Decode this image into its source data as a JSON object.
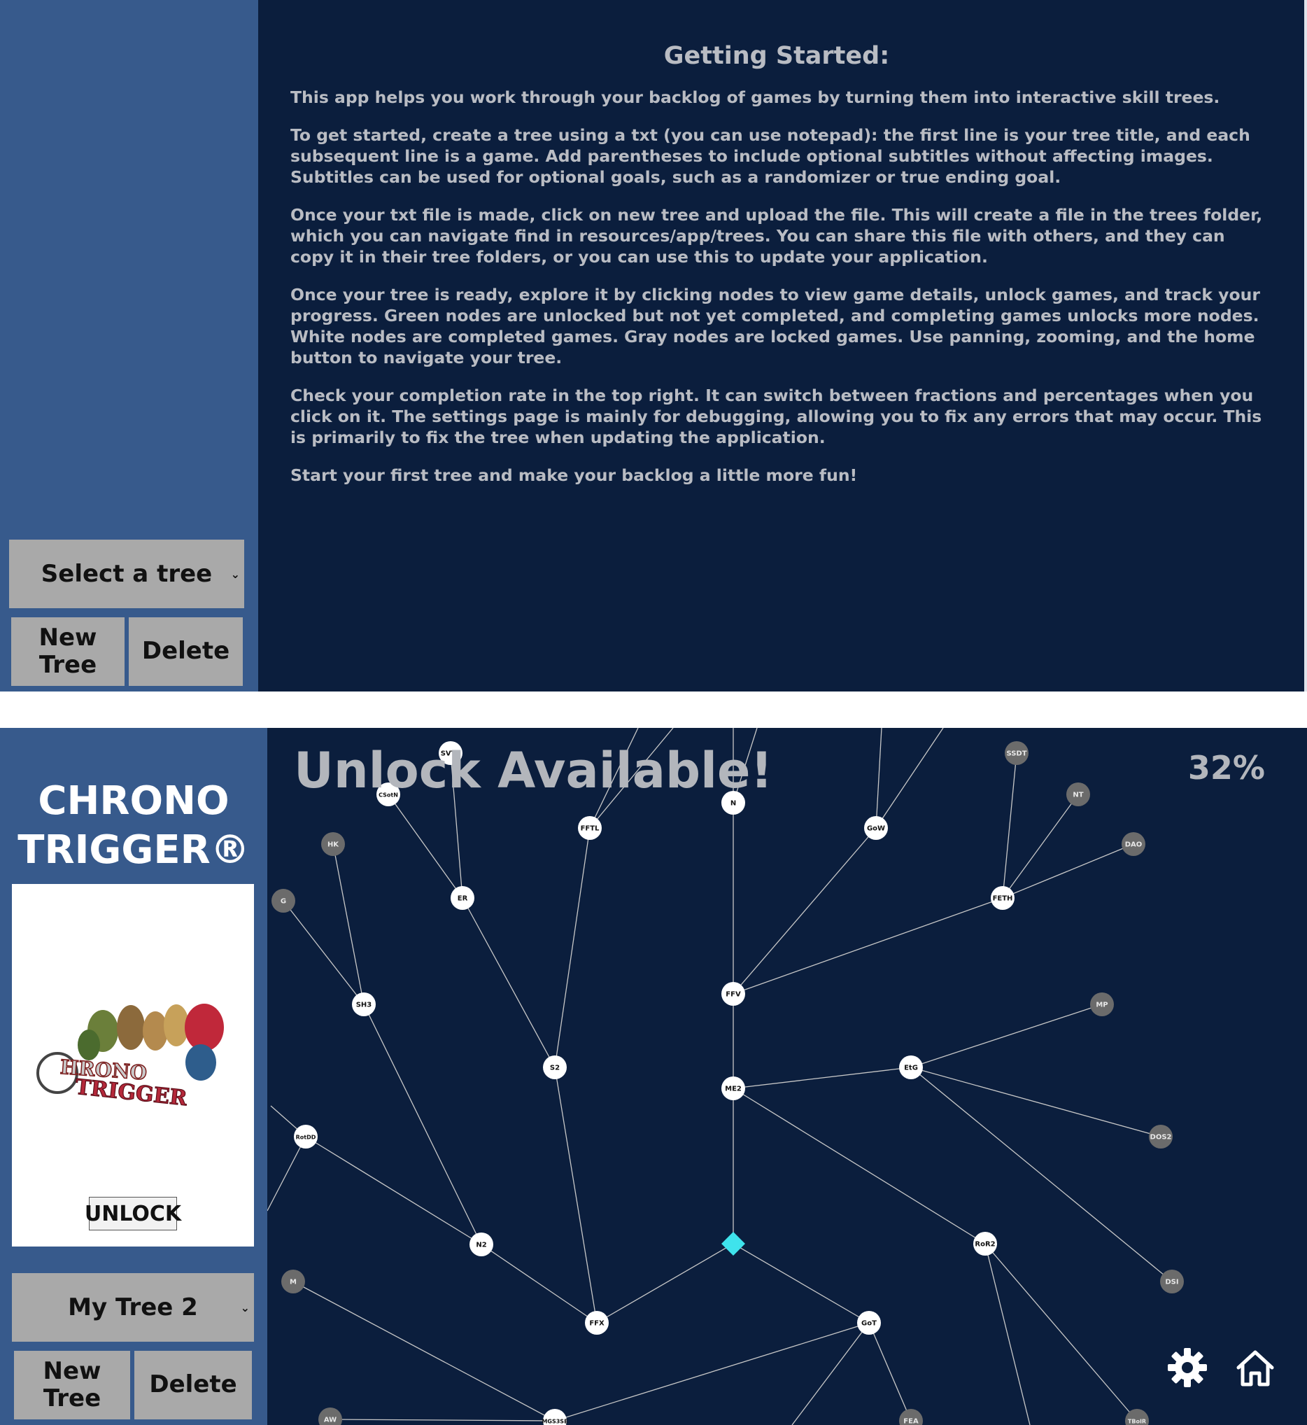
{
  "top_screen": {
    "heading": "Getting Started:",
    "paragraphs": [
      "This app helps you work through your backlog of games by turning them into interactive skill trees.",
      "To get started, create a tree using a txt (you can use notepad): the first line is your tree title, and each subsequent line is a game. Add parentheses to include optional subtitles without affecting images. Subtitles can be used for optional goals, such as a randomizer or true ending goal.",
      "Once your txt file is made, click on new tree and upload the file. This will create a file in the trees folder, which you can navigate find in resources/app/trees. You can share this file with others, and they can copy it in their tree folders, or you can use this to update your application.",
      "Once your tree is ready, explore it by clicking nodes to view game details, unlock games, and track your progress. Green nodes are unlocked but not yet completed, and completing games unlocks more nodes. White nodes are completed games. Gray nodes are locked games. Use panning, zooming, and the home button to navigate your tree.",
      "Check your completion rate in the top right. It can switch between fractions and percentages when you click on it. The settings page is mainly for debugging, allowing you to fix any errors that may occur. This is primarily to fix the tree when updating the application.",
      "Start your first tree and make your backlog a little more fun!"
    ],
    "tree_select": "Select a tree",
    "new_tree_button": "New Tree",
    "delete_button": "Delete"
  },
  "bottom_screen": {
    "game_title": "CHRONO TRIGGER®",
    "logo_text": "HRONO TRIGGER",
    "unlock_button": "UNLOCK",
    "tree_select": "My Tree 2",
    "new_tree_button": "New Tree",
    "delete_button": "Delete",
    "banner": "Unlock Available!",
    "completion": "32%",
    "icons": {
      "settings": "gear-icon",
      "home": "home-icon"
    }
  },
  "colors": {
    "background": "#0b1e3d",
    "sidebar": "#375a8c",
    "button": "#a9a9a9",
    "node_completed": "#ffffff",
    "node_locked": "#6b6b6b",
    "node_current": "#3fe3ec",
    "edge": "#c8c8c8",
    "text_muted": "#b3b6bc"
  },
  "tree_nodes": [
    {
      "id": "SVTF",
      "label": "SVTF",
      "state": "completed"
    },
    {
      "id": "SSDT",
      "label": "SSDT",
      "state": "locked"
    },
    {
      "id": "CSotN",
      "label": "CSotN",
      "state": "completed"
    },
    {
      "id": "N",
      "label": "N",
      "state": "completed"
    },
    {
      "id": "NT",
      "label": "NT",
      "state": "locked"
    },
    {
      "id": "FFTL",
      "label": "FFTL",
      "state": "completed"
    },
    {
      "id": "GoW",
      "label": "GoW",
      "state": "completed"
    },
    {
      "id": "HK",
      "label": "HK",
      "state": "locked"
    },
    {
      "id": "DAO",
      "label": "DAO",
      "state": "locked"
    },
    {
      "id": "ER",
      "label": "ER",
      "state": "completed"
    },
    {
      "id": "FETH",
      "label": "FETH",
      "state": "completed"
    },
    {
      "id": "G",
      "label": "G",
      "state": "locked"
    },
    {
      "id": "FFV",
      "label": "FFV",
      "state": "completed"
    },
    {
      "id": "SH3",
      "label": "SH3",
      "state": "completed"
    },
    {
      "id": "MP",
      "label": "MP",
      "state": "locked"
    },
    {
      "id": "S2",
      "label": "S2",
      "state": "completed"
    },
    {
      "id": "EtG",
      "label": "EtG",
      "state": "completed"
    },
    {
      "id": "ME2",
      "label": "ME2",
      "state": "completed"
    },
    {
      "id": "RotDD",
      "label": "RotDD",
      "state": "completed"
    },
    {
      "id": "DOS2",
      "label": "DOS2",
      "state": "locked"
    },
    {
      "id": "N2",
      "label": "N2",
      "state": "completed"
    },
    {
      "id": "ROOT",
      "label": "",
      "state": "current"
    },
    {
      "id": "RoR2",
      "label": "RoR2",
      "state": "completed"
    },
    {
      "id": "M",
      "label": "M",
      "state": "locked"
    },
    {
      "id": "DSI",
      "label": "DSI",
      "state": "locked"
    },
    {
      "id": "FFX",
      "label": "FFX",
      "state": "completed"
    },
    {
      "id": "GoT",
      "label": "GoT",
      "state": "completed"
    },
    {
      "id": "AW",
      "label": "AW",
      "state": "locked"
    },
    {
      "id": "MGS3SE",
      "label": "MGS3SE",
      "state": "completed"
    },
    {
      "id": "FEA",
      "label": "FEA",
      "state": "locked"
    },
    {
      "id": "TBoIR",
      "label": "TBoIR",
      "state": "locked"
    }
  ],
  "tree_edges": [
    [
      "ROOT",
      "ME2"
    ],
    [
      "ME2",
      "FFV"
    ],
    [
      "FFV",
      "N"
    ],
    [
      "FFV",
      "GoW"
    ],
    [
      "FFV",
      "FETH"
    ],
    [
      "FETH",
      "SSDT"
    ],
    [
      "FETH",
      "NT"
    ],
    [
      "FETH",
      "DAO"
    ],
    [
      "ME2",
      "EtG"
    ],
    [
      "EtG",
      "MP"
    ],
    [
      "EtG",
      "DOS2"
    ],
    [
      "EtG",
      "DSI"
    ],
    [
      "ME2",
      "RoR2"
    ],
    [
      "ROOT",
      "FFX"
    ],
    [
      "FFX",
      "S2"
    ],
    [
      "S2",
      "ER"
    ],
    [
      "ER",
      "CSotN"
    ],
    [
      "ER",
      "SVTF"
    ],
    [
      "S2",
      "FFTL"
    ],
    [
      "FFX",
      "N2"
    ],
    [
      "N2",
      "SH3"
    ],
    [
      "SH3",
      "HK"
    ],
    [
      "SH3",
      "G"
    ],
    [
      "N2",
      "RotDD"
    ],
    [
      "ROOT",
      "GoT"
    ],
    [
      "GoT",
      "MGS3SE"
    ],
    [
      "MGS3SE",
      "M"
    ],
    [
      "MGS3SE",
      "AW"
    ],
    [
      "GoT",
      "FEA"
    ],
    [
      "RoR2",
      "TBoIR"
    ]
  ]
}
